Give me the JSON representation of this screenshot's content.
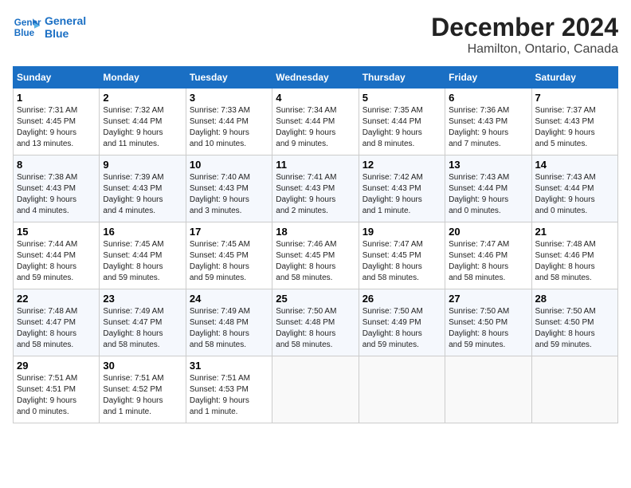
{
  "logo": {
    "line1": "General",
    "line2": "Blue"
  },
  "title": "December 2024",
  "subtitle": "Hamilton, Ontario, Canada",
  "days_of_week": [
    "Sunday",
    "Monday",
    "Tuesday",
    "Wednesday",
    "Thursday",
    "Friday",
    "Saturday"
  ],
  "weeks": [
    [
      {
        "day": 1,
        "info": "Sunrise: 7:31 AM\nSunset: 4:45 PM\nDaylight: 9 hours\nand 13 minutes."
      },
      {
        "day": 2,
        "info": "Sunrise: 7:32 AM\nSunset: 4:44 PM\nDaylight: 9 hours\nand 11 minutes."
      },
      {
        "day": 3,
        "info": "Sunrise: 7:33 AM\nSunset: 4:44 PM\nDaylight: 9 hours\nand 10 minutes."
      },
      {
        "day": 4,
        "info": "Sunrise: 7:34 AM\nSunset: 4:44 PM\nDaylight: 9 hours\nand 9 minutes."
      },
      {
        "day": 5,
        "info": "Sunrise: 7:35 AM\nSunset: 4:44 PM\nDaylight: 9 hours\nand 8 minutes."
      },
      {
        "day": 6,
        "info": "Sunrise: 7:36 AM\nSunset: 4:43 PM\nDaylight: 9 hours\nand 7 minutes."
      },
      {
        "day": 7,
        "info": "Sunrise: 7:37 AM\nSunset: 4:43 PM\nDaylight: 9 hours\nand 5 minutes."
      }
    ],
    [
      {
        "day": 8,
        "info": "Sunrise: 7:38 AM\nSunset: 4:43 PM\nDaylight: 9 hours\nand 4 minutes."
      },
      {
        "day": 9,
        "info": "Sunrise: 7:39 AM\nSunset: 4:43 PM\nDaylight: 9 hours\nand 4 minutes."
      },
      {
        "day": 10,
        "info": "Sunrise: 7:40 AM\nSunset: 4:43 PM\nDaylight: 9 hours\nand 3 minutes."
      },
      {
        "day": 11,
        "info": "Sunrise: 7:41 AM\nSunset: 4:43 PM\nDaylight: 9 hours\nand 2 minutes."
      },
      {
        "day": 12,
        "info": "Sunrise: 7:42 AM\nSunset: 4:43 PM\nDaylight: 9 hours\nand 1 minute."
      },
      {
        "day": 13,
        "info": "Sunrise: 7:43 AM\nSunset: 4:44 PM\nDaylight: 9 hours\nand 0 minutes."
      },
      {
        "day": 14,
        "info": "Sunrise: 7:43 AM\nSunset: 4:44 PM\nDaylight: 9 hours\nand 0 minutes."
      }
    ],
    [
      {
        "day": 15,
        "info": "Sunrise: 7:44 AM\nSunset: 4:44 PM\nDaylight: 8 hours\nand 59 minutes."
      },
      {
        "day": 16,
        "info": "Sunrise: 7:45 AM\nSunset: 4:44 PM\nDaylight: 8 hours\nand 59 minutes."
      },
      {
        "day": 17,
        "info": "Sunrise: 7:45 AM\nSunset: 4:45 PM\nDaylight: 8 hours\nand 59 minutes."
      },
      {
        "day": 18,
        "info": "Sunrise: 7:46 AM\nSunset: 4:45 PM\nDaylight: 8 hours\nand 58 minutes."
      },
      {
        "day": 19,
        "info": "Sunrise: 7:47 AM\nSunset: 4:45 PM\nDaylight: 8 hours\nand 58 minutes."
      },
      {
        "day": 20,
        "info": "Sunrise: 7:47 AM\nSunset: 4:46 PM\nDaylight: 8 hours\nand 58 minutes."
      },
      {
        "day": 21,
        "info": "Sunrise: 7:48 AM\nSunset: 4:46 PM\nDaylight: 8 hours\nand 58 minutes."
      }
    ],
    [
      {
        "day": 22,
        "info": "Sunrise: 7:48 AM\nSunset: 4:47 PM\nDaylight: 8 hours\nand 58 minutes."
      },
      {
        "day": 23,
        "info": "Sunrise: 7:49 AM\nSunset: 4:47 PM\nDaylight: 8 hours\nand 58 minutes."
      },
      {
        "day": 24,
        "info": "Sunrise: 7:49 AM\nSunset: 4:48 PM\nDaylight: 8 hours\nand 58 minutes."
      },
      {
        "day": 25,
        "info": "Sunrise: 7:50 AM\nSunset: 4:48 PM\nDaylight: 8 hours\nand 58 minutes."
      },
      {
        "day": 26,
        "info": "Sunrise: 7:50 AM\nSunset: 4:49 PM\nDaylight: 8 hours\nand 59 minutes."
      },
      {
        "day": 27,
        "info": "Sunrise: 7:50 AM\nSunset: 4:50 PM\nDaylight: 8 hours\nand 59 minutes."
      },
      {
        "day": 28,
        "info": "Sunrise: 7:50 AM\nSunset: 4:50 PM\nDaylight: 8 hours\nand 59 minutes."
      }
    ],
    [
      {
        "day": 29,
        "info": "Sunrise: 7:51 AM\nSunset: 4:51 PM\nDaylight: 9 hours\nand 0 minutes."
      },
      {
        "day": 30,
        "info": "Sunrise: 7:51 AM\nSunset: 4:52 PM\nDaylight: 9 hours\nand 1 minute."
      },
      {
        "day": 31,
        "info": "Sunrise: 7:51 AM\nSunset: 4:53 PM\nDaylight: 9 hours\nand 1 minute."
      },
      null,
      null,
      null,
      null
    ]
  ]
}
